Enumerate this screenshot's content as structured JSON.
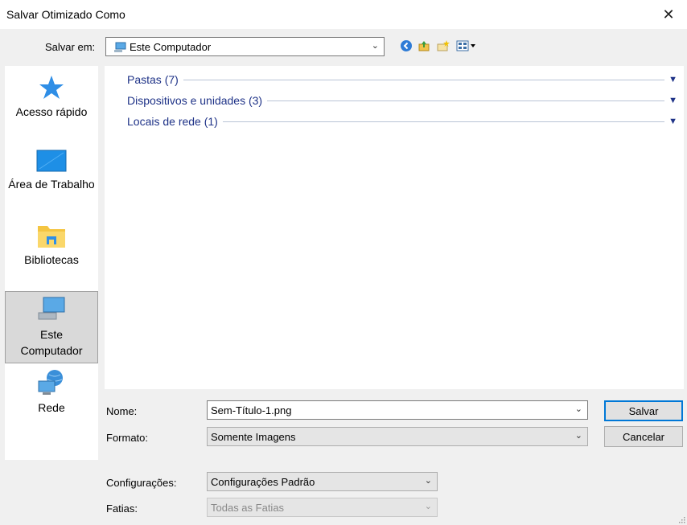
{
  "window": {
    "title": "Salvar Otimizado Como"
  },
  "icons": {
    "close": "close-icon",
    "back": "back-icon",
    "up": "up-folder-icon",
    "new_folder": "new-folder-icon",
    "view": "view-menu-icon"
  },
  "location": {
    "label": "Salvar em:",
    "value": "Este Computador"
  },
  "places": [
    {
      "label": "Acesso rápido"
    },
    {
      "label": "Área de Trabalho"
    },
    {
      "label": "Bibliotecas"
    },
    {
      "label": "Este Computador"
    },
    {
      "label": "Rede"
    }
  ],
  "groups": [
    {
      "label": "Pastas (7)"
    },
    {
      "label": "Dispositivos e unidades (3)"
    },
    {
      "label": "Locais de rede (1)"
    }
  ],
  "form": {
    "name_label": "Nome:",
    "name_value": "Sem-Título-1.png",
    "format_label": "Formato:",
    "format_value": "Somente Imagens",
    "settings_label": "Configurações:",
    "settings_value": "Configurações Padrão",
    "slices_label": "Fatias:",
    "slices_value": "Todas as Fatias"
  },
  "buttons": {
    "save": "Salvar",
    "cancel": "Cancelar"
  },
  "colors": {
    "accent": "#0078d7",
    "group_text": "#1e3287",
    "selected_place": "#d9d9d9"
  }
}
